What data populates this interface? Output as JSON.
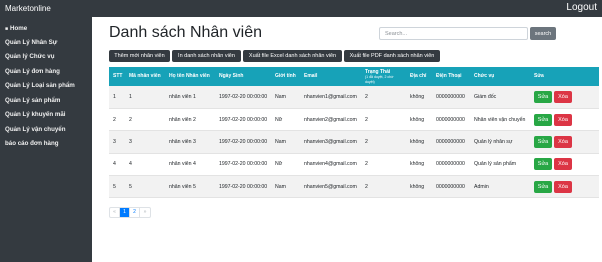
{
  "app": {
    "brand": "Marketonline",
    "logout_label": "Logout"
  },
  "sidebar": {
    "items": [
      {
        "label": "Home",
        "icon": "home-icon"
      },
      {
        "label": "Quản Lý Nhân Sự"
      },
      {
        "label": "Quản lý Chức vụ"
      },
      {
        "label": "Quản Lý đơn hàng"
      },
      {
        "label": "Quản Lý Loại sản phẩm"
      },
      {
        "label": "Quản Lý sản phẩm"
      },
      {
        "label": "Quản Lý khuyến mãi"
      },
      {
        "label": "Quản Lý vận chuyển"
      },
      {
        "label": "báo cáo đơn hàng"
      }
    ]
  },
  "page": {
    "title": "Danh sách Nhân viên"
  },
  "search": {
    "placeholder": "Search...",
    "button_label": "search"
  },
  "actions": {
    "add": "Thêm mới nhân viên",
    "print": "In danh sách nhân viên",
    "export_excel": "Xuất file Excel danh sách nhân viên",
    "export_pdf": "Xuất file PDF danh sách nhân viên"
  },
  "table": {
    "headers": {
      "stt": "STT",
      "code": "Mã nhân viên",
      "name": "Họ tên Nhân viên",
      "dob": "Ngày Sinh",
      "gender": "Giới tính",
      "email": "Email",
      "status": "Trạng Thái",
      "status_sub": "(1 đã duyệt, 2 chờ duyệt)",
      "address": "Địa chỉ",
      "phone": "Điện Thoại",
      "position": "Chức vụ",
      "edit": "Sửa"
    },
    "rows": [
      {
        "stt": "1",
        "code": "1",
        "name": "nhân viên 1",
        "dob": "1997-02-20 00:00:00",
        "gender": "Nam",
        "email": "nhanvien1@gmail.com",
        "status": "2",
        "address": "không",
        "phone": "0000000000",
        "position": "Giám đốc",
        "edit_label": "Sửa",
        "delete_label": "Xóa"
      },
      {
        "stt": "2",
        "code": "2",
        "name": "nhân viên 2",
        "dob": "1997-02-20 00:00:00",
        "gender": "Nữ",
        "email": "nhanvien2@gmail.com",
        "status": "2",
        "address": "không",
        "phone": "0000000000",
        "position": "Nhân viên vận chuyển",
        "edit_label": "Sửa",
        "delete_label": "Xóa"
      },
      {
        "stt": "3",
        "code": "3",
        "name": "nhân viên 3",
        "dob": "1997-02-20 00:00:00",
        "gender": "Nam",
        "email": "nhanvien3@gmail.com",
        "status": "2",
        "address": "không",
        "phone": "0000000000",
        "position": "Quản lý nhân sự",
        "edit_label": "Sửa",
        "delete_label": "Xóa"
      },
      {
        "stt": "4",
        "code": "4",
        "name": "nhân viên 4",
        "dob": "1997-02-20 00:00:00",
        "gender": "Nữ",
        "email": "nhanvien4@gmail.com",
        "status": "2",
        "address": "không",
        "phone": "0000000000",
        "position": "Quản lý sản phẩm",
        "edit_label": "Sửa",
        "delete_label": "Xóa"
      },
      {
        "stt": "5",
        "code": "5",
        "name": "nhân viên 5",
        "dob": "1997-02-20 00:00:00",
        "gender": "Nam",
        "email": "nhanvien5@gmail.com",
        "status": "2",
        "address": "không",
        "phone": "0000000000",
        "position": "Admin",
        "edit_label": "Sửa",
        "delete_label": "Xóa"
      }
    ]
  },
  "pagination": {
    "prev": "«",
    "pages": [
      "1",
      "2"
    ],
    "next": "»",
    "current": "1"
  },
  "colors": {
    "dark": "#343a40",
    "header": "#17a2b8",
    "edit": "#28a745",
    "delete": "#dc3545",
    "primary": "#007bff"
  }
}
